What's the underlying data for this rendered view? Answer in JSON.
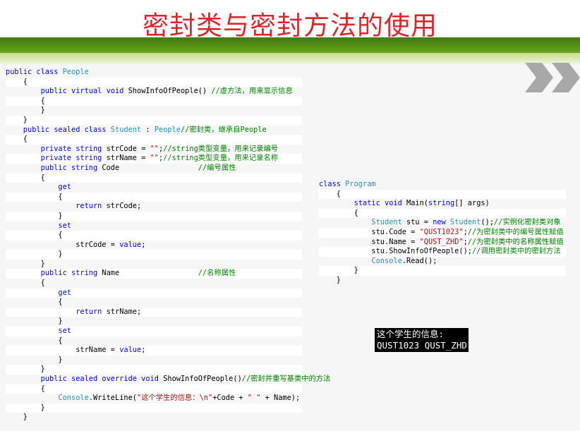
{
  "slide": {
    "title": "密封类与密封方法的使用"
  },
  "colors": {
    "title": "#e0242a",
    "keyword": "#0000ff",
    "type": "#2b91af",
    "string": "#a31515",
    "comment": "#008000",
    "band": "#5a9416"
  },
  "icons": [
    "chevron-right-icon",
    "chevron-right-icon"
  ],
  "code_left": [
    [
      {
        "t": "public class ",
        "c": "k"
      },
      {
        "t": "People",
        "c": "t"
      }
    ],
    [
      {
        "t": "    {"
      }
    ],
    [
      {
        "t": "        public virtual void ",
        "c": "k"
      },
      {
        "t": "ShowInfoOfPeople() "
      },
      {
        "t": "//虚方法，用来显示信息",
        "c": "c"
      }
    ],
    [
      {
        "t": "        {"
      }
    ],
    [
      {
        "t": "        }"
      }
    ],
    [
      {
        "t": "    }"
      }
    ],
    [
      {
        "t": "    public sealed class ",
        "c": "k"
      },
      {
        "t": "Student",
        "c": "t"
      },
      {
        "t": " : "
      },
      {
        "t": "People",
        "c": "t"
      },
      {
        "t": "//密封类，继承自People",
        "c": "c"
      }
    ],
    [
      {
        "t": "    {"
      }
    ],
    [
      {
        "t": "        private string ",
        "c": "k"
      },
      {
        "t": "strCode = "
      },
      {
        "t": "\"\"",
        "c": "s"
      },
      {
        "t": ";"
      },
      {
        "t": "//string类型变量，用来记录编号",
        "c": "c"
      }
    ],
    [
      {
        "t": "        private string ",
        "c": "k"
      },
      {
        "t": "strName = "
      },
      {
        "t": "\"\"",
        "c": "s"
      },
      {
        "t": ";"
      },
      {
        "t": "//string类型变量，用来记录名称",
        "c": "c"
      }
    ],
    [
      {
        "t": "        public string ",
        "c": "k"
      },
      {
        "t": "Code                  "
      },
      {
        "t": "//编号属性",
        "c": "c"
      }
    ],
    [
      {
        "t": "        {"
      }
    ],
    [
      {
        "t": "            get",
        "c": "k"
      }
    ],
    [
      {
        "t": "            {"
      }
    ],
    [
      {
        "t": "                return ",
        "c": "k"
      },
      {
        "t": "strCode;"
      }
    ],
    [
      {
        "t": "            }"
      }
    ],
    [
      {
        "t": "            set",
        "c": "k"
      }
    ],
    [
      {
        "t": "            {"
      }
    ],
    [
      {
        "t": "                "
      },
      {
        "t": "strCode = "
      },
      {
        "t": "value",
        "c": "k"
      },
      {
        "t": ";"
      }
    ],
    [
      {
        "t": "            }"
      }
    ],
    [
      {
        "t": "        }"
      }
    ],
    [
      {
        "t": "        public string ",
        "c": "k"
      },
      {
        "t": "Name                  "
      },
      {
        "t": "//名称属性",
        "c": "c"
      }
    ],
    [
      {
        "t": "        {"
      }
    ],
    [
      {
        "t": "            get",
        "c": "k"
      }
    ],
    [
      {
        "t": "            {"
      }
    ],
    [
      {
        "t": "                return ",
        "c": "k"
      },
      {
        "t": "strName;"
      }
    ],
    [
      {
        "t": "            }"
      }
    ],
    [
      {
        "t": "            set",
        "c": "k"
      }
    ],
    [
      {
        "t": "            {"
      }
    ],
    [
      {
        "t": "                "
      },
      {
        "t": "strName = "
      },
      {
        "t": "value",
        "c": "k"
      },
      {
        "t": ";"
      }
    ],
    [
      {
        "t": "            }"
      }
    ],
    [
      {
        "t": "        }"
      }
    ],
    [
      {
        "t": "        public sealed override void ",
        "c": "k"
      },
      {
        "t": "ShowInfoOfPeople()"
      },
      {
        "t": "//密封并重写基类中的方法",
        "c": "c"
      }
    ],
    [
      {
        "t": "        {"
      }
    ],
    [
      {
        "t": "            "
      },
      {
        "t": "Console",
        "c": "t"
      },
      {
        "t": ".WriteLine("
      },
      {
        "t": "\"这个学生的信息：\\n\"",
        "c": "s"
      },
      {
        "t": "+Code + "
      },
      {
        "t": "\" \"",
        "c": "s"
      },
      {
        "t": " + Name);"
      }
    ],
    [
      {
        "t": "        }"
      }
    ],
    [
      {
        "t": "    }"
      }
    ]
  ],
  "code_right": [
    [
      {
        "t": "class ",
        "c": "k"
      },
      {
        "t": "Program",
        "c": "t"
      }
    ],
    [
      {
        "t": "    {"
      }
    ],
    [
      {
        "t": "        static void ",
        "c": "k"
      },
      {
        "t": "Main("
      },
      {
        "t": "string",
        "c": "k"
      },
      {
        "t": "[] args)"
      }
    ],
    [
      {
        "t": "        {"
      }
    ],
    [
      {
        "t": "            "
      },
      {
        "t": "Student",
        "c": "t"
      },
      {
        "t": " stu = "
      },
      {
        "t": "new ",
        "c": "k"
      },
      {
        "t": "Student",
        "c": "t"
      },
      {
        "t": "();"
      },
      {
        "t": "//实例化密封类对象",
        "c": "c"
      }
    ],
    [
      {
        "t": "            stu.Code = "
      },
      {
        "t": "\"QUST1023\"",
        "c": "s"
      },
      {
        "t": ";"
      },
      {
        "t": "//为密封类中的编号属性赋值",
        "c": "c"
      }
    ],
    [
      {
        "t": "            stu.Name = "
      },
      {
        "t": "\"QUST_ZHD\"",
        "c": "s"
      },
      {
        "t": ";"
      },
      {
        "t": "//为密封类中的名称属性赋值",
        "c": "c"
      }
    ],
    [
      {
        "t": "            stu.ShowInfoOfPeople();"
      },
      {
        "t": "//调用密封类中的密封方法",
        "c": "c"
      }
    ],
    [
      {
        "t": "            "
      },
      {
        "t": "Console",
        "c": "t"
      },
      {
        "t": ".Read();"
      }
    ],
    [
      {
        "t": "        }"
      }
    ],
    [
      {
        "t": "    }"
      }
    ]
  ],
  "console_output": {
    "line1": "这个学生的信息:",
    "line2": "QUST1023 QUST_ZHD"
  }
}
